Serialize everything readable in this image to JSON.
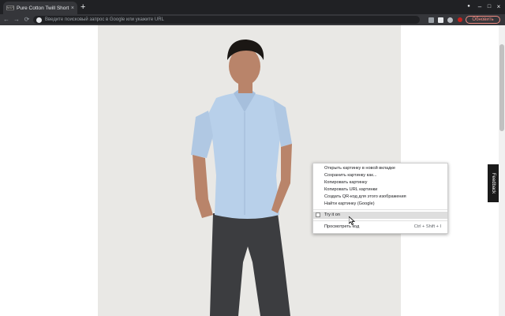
{
  "tab": {
    "title": "Pure Cotton Twill Short Sl",
    "favicon_text": "M&S",
    "close_glyph": "×"
  },
  "newtab_glyph": "+",
  "window_controls": {
    "minimize": "–",
    "restore": "□",
    "close": "×",
    "account": "●"
  },
  "toolbar": {
    "back": "←",
    "forward": "→",
    "reload": "⟳",
    "omnibox_placeholder": "Введите поисковый запрос в Google или укажите URL",
    "update_label": "Обновить"
  },
  "feedback_label": "Feedback",
  "context_menu": {
    "items": [
      "Открыть картинку в новой вкладке",
      "Сохранить картинку как...",
      "Копировать картинку",
      "Копировать URL картинки",
      "Создать QR-код для этого изображения",
      "Найти картинку (Google)"
    ],
    "tryiton_label": "Try it on",
    "inspect_label": "Просмотреть код",
    "inspect_shortcut": "Ctrl + Shift + I"
  },
  "colors": {
    "tabbar": "#202124",
    "toolbar": "#35363a",
    "shirt": "#b8d0ea",
    "trousers": "#3c3d40",
    "skin": "#b9846a",
    "hair": "#1b1714",
    "photo_bg": "#e9e8e5",
    "update_accent": "#f28b82"
  }
}
